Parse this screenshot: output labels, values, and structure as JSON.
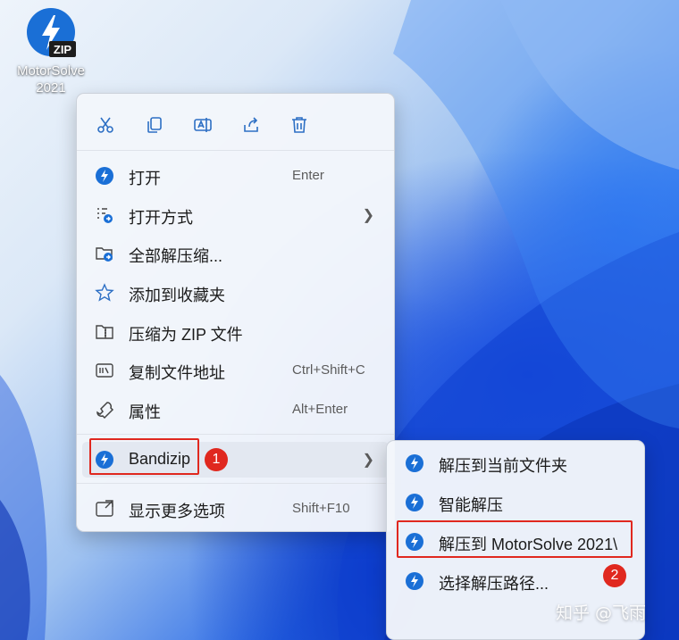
{
  "desktop": {
    "icon_badge": "ZIP",
    "icon_label_line1": "MotorSolve",
    "icon_label_line2": "2021"
  },
  "toolbar": {
    "buttons": [
      "cut-icon",
      "copy-icon",
      "rename-icon",
      "share-icon",
      "delete-icon"
    ]
  },
  "menu": {
    "items": [
      {
        "label": "打开",
        "shortcut": "Enter",
        "icon": "bandizip-icon"
      },
      {
        "label": "打开方式",
        "shortcut": "",
        "icon": "open-with-icon",
        "submenu": true
      },
      {
        "label": "全部解压缩...",
        "shortcut": "",
        "icon": "extract-all-icon"
      },
      {
        "label": "添加到收藏夹",
        "shortcut": "",
        "icon": "star-icon"
      },
      {
        "label": "压缩为 ZIP 文件",
        "shortcut": "",
        "icon": "zip-folder-icon"
      },
      {
        "label": "复制文件地址",
        "shortcut": "Ctrl+Shift+C",
        "icon": "copy-path-icon"
      },
      {
        "label": "属性",
        "shortcut": "Alt+Enter",
        "icon": "wrench-icon"
      },
      {
        "label": "Bandizip",
        "shortcut": "",
        "icon": "bandizip-icon",
        "submenu": true
      },
      {
        "label": "显示更多选项",
        "shortcut": "Shift+F10",
        "icon": "more-options-icon"
      }
    ]
  },
  "submenu": {
    "items": [
      {
        "label": "解压到当前文件夹"
      },
      {
        "label": "智能解压"
      },
      {
        "label": "解压到 MotorSolve 2021\\"
      },
      {
        "label": "选择解压路径..."
      }
    ]
  },
  "annotations": {
    "badge1": "1",
    "badge2": "2",
    "highlight_color": "#e0281f"
  },
  "watermark": "知乎 @飞雨",
  "colors": {
    "accent": "#1a6fd6",
    "wallpaper_blue": "#1046d6"
  }
}
